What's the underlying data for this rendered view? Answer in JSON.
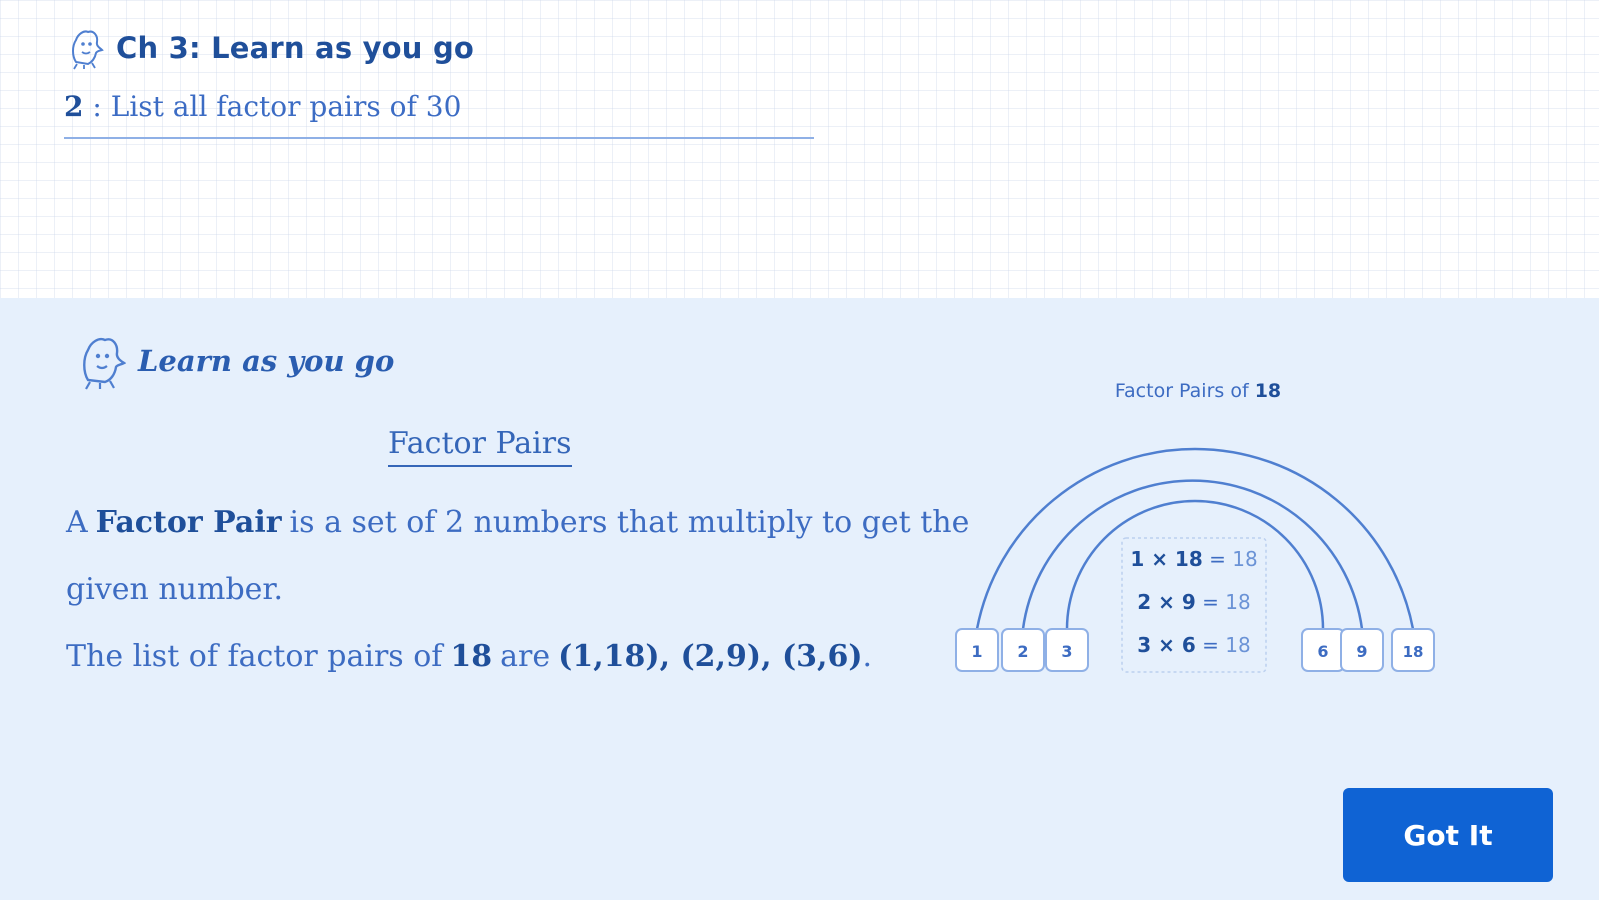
{
  "header": {
    "chapter_title": "Ch 3: Learn as you go",
    "question_number": "2",
    "question_separator": " : ",
    "question_text": "List all factor pairs of 30"
  },
  "panel": {
    "title": "Learn as you go",
    "section_title": "Factor Pairs",
    "definition": {
      "prefix": "A",
      "term": "Factor Pair",
      "rest": "is a set of 2 numbers that multiply to get the",
      "continued": "given number."
    },
    "example": {
      "prefix": "The list of factor pairs of",
      "number": "18",
      "middle": "are",
      "pairs": "(1,18), (2,9), (3,6)",
      "end": "."
    },
    "diagram": {
      "title_prefix": "Factor Pairs of ",
      "title_number": "18",
      "factors": [
        "1",
        "2",
        "3",
        "6",
        "9",
        "18"
      ],
      "equations": [
        {
          "lhs": "1 × 18",
          "eq": " = ",
          "rhs": "18"
        },
        {
          "lhs": "2 × 9",
          "eq": " = ",
          "rhs": "18"
        },
        {
          "lhs": "3 × 6",
          "eq": " = ",
          "rhs": "18"
        }
      ]
    },
    "button_label": "Got It"
  },
  "colors": {
    "accent": "#0f63d4",
    "panel_bg": "#e6f0fc",
    "text_blue": "#3d6cc2",
    "line_blue": "#4f7fd0"
  },
  "icons": [
    "learning-mascot-icon"
  ]
}
